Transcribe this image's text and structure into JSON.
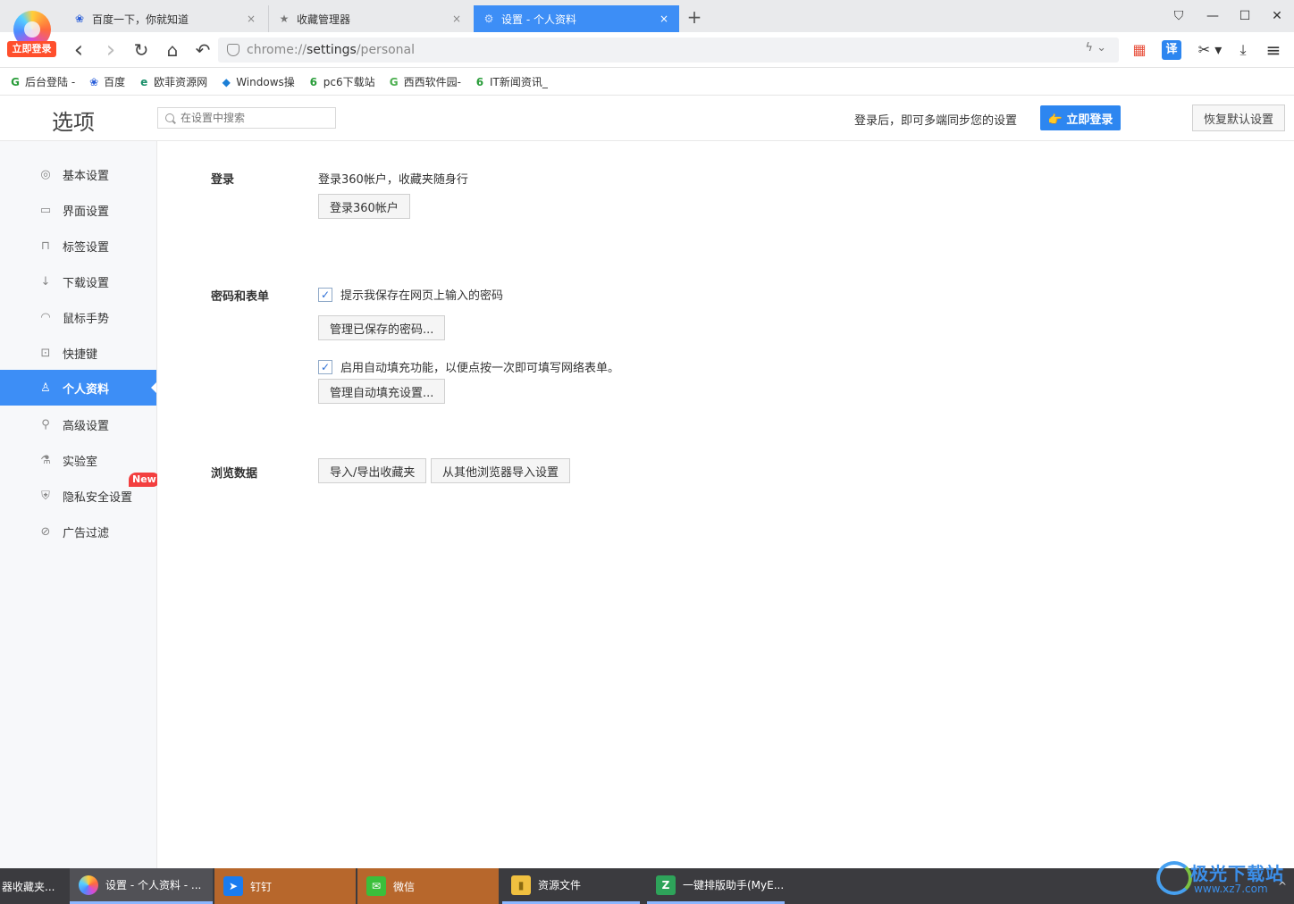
{
  "browser": {
    "login_tag": "立即登录",
    "tabs": [
      {
        "title": "百度一下，你就知道",
        "icon": "baidu-paw-icon",
        "close": "×"
      },
      {
        "title": "收藏管理器",
        "icon": "star-icon",
        "close": "×"
      },
      {
        "title": "设置 - 个人资料",
        "icon": "gear-icon",
        "close": "×"
      }
    ],
    "new_tab": "+",
    "window": {
      "skin": "⛉",
      "minimize": "—",
      "maximize": "☐",
      "close": "✕"
    },
    "nav": {
      "back": "‹",
      "forward": "›",
      "reload": "↻",
      "home": "⌂",
      "undo": "↶"
    },
    "address": {
      "scheme": "chrome://",
      "host": "settings",
      "path": "/personal",
      "tail": "ϟ ⌄"
    },
    "toolbar_icons": {
      "apps": "▦",
      "translate": "译",
      "cut": "✂ ▾",
      "download": "⤓",
      "menu": "≡"
    },
    "bookmarks": [
      {
        "label": "后台登陆 -",
        "icon": "G",
        "color": "#2a9d3a"
      },
      {
        "label": "百度",
        "icon": "❀",
        "color": "#2b5fd9"
      },
      {
        "label": "欧菲资源网",
        "icon": "e",
        "color": "#1a8f6a"
      },
      {
        "label": "Windows操",
        "icon": "◆",
        "color": "#1c7fd6"
      },
      {
        "label": "pc6下载站",
        "icon": "6",
        "color": "#2a9d3a"
      },
      {
        "label": "西西软件园-",
        "icon": "G",
        "color": "#4caf50"
      },
      {
        "label": "IT新闻资讯_",
        "icon": "6",
        "color": "#2a9d3a"
      }
    ]
  },
  "header": {
    "title": "选项",
    "search_placeholder": "在设置中搜索",
    "sync_text": "登录后，即可多端同步您的设置",
    "login_button": "👉 立即登录",
    "restore_button": "恢复默认设置"
  },
  "sidebar": {
    "items": [
      {
        "label": "基本设置",
        "icon": "◎"
      },
      {
        "label": "界面设置",
        "icon": "▭"
      },
      {
        "label": "标签设置",
        "icon": "⊓"
      },
      {
        "label": "下载设置",
        "icon": "↓"
      },
      {
        "label": "鼠标手势",
        "icon": "◠"
      },
      {
        "label": "快捷键",
        "icon": "⊡"
      },
      {
        "label": "个人资料",
        "icon": "♙",
        "active": true
      },
      {
        "label": "高级设置",
        "icon": "⚲"
      },
      {
        "label": "实验室",
        "icon": "⚗"
      },
      {
        "label": "隐私安全设置",
        "icon": "⛨",
        "badge": "New"
      },
      {
        "label": "广告过滤",
        "icon": "⊘"
      }
    ]
  },
  "content": {
    "login": {
      "label": "登录",
      "desc": "登录360帐户，收藏夹随身行",
      "button": "登录360帐户"
    },
    "passwords": {
      "label": "密码和表单",
      "save_pw_checkbox": "提示我保存在网页上输入的密码",
      "save_pw_checked": true,
      "manage_pw_button": "管理已保存的密码...",
      "autofill_checkbox": "启用自动填充功能，以便点按一次即可填写网络表单。",
      "autofill_checked": true,
      "manage_autofill_button": "管理自动填充设置..."
    },
    "browsing": {
      "label": "浏览数据",
      "import_export_button": "导入/导出收藏夹",
      "import_other_button": "从其他浏览器导入设置"
    }
  },
  "taskbar": {
    "items": [
      {
        "label": "器收藏夹..."
      },
      {
        "label": "设置 - 个人资料 - ...",
        "icon": "◉"
      },
      {
        "label": "钉钉",
        "icon": "➤"
      },
      {
        "label": "微信",
        "icon": "✉"
      },
      {
        "label": "资源文件",
        "icon": "▮"
      },
      {
        "label": "一键排版助手(MyE...",
        "icon": "Z"
      }
    ],
    "watermark_main": "极光下载站",
    "watermark_sub": "www.xz7.com",
    "tray_arrow": "^"
  }
}
